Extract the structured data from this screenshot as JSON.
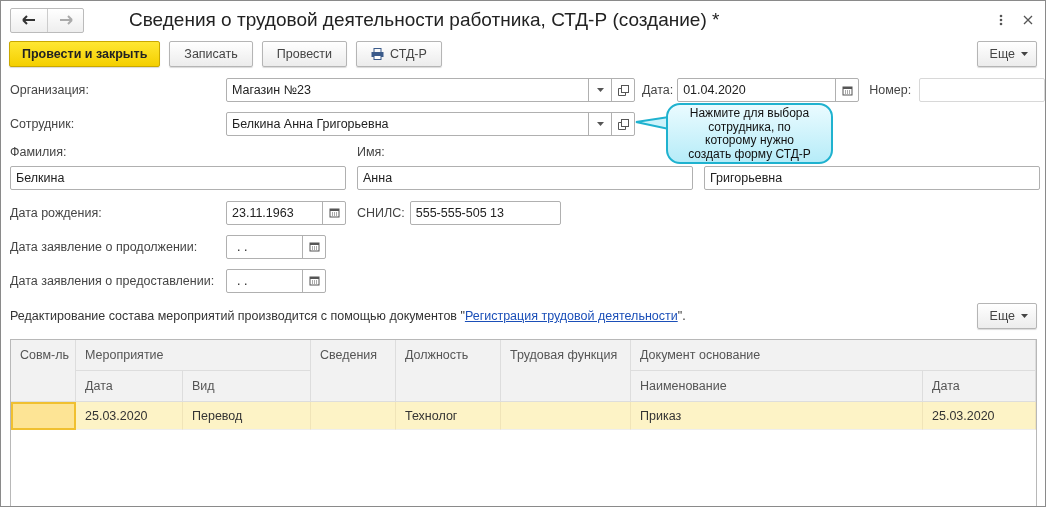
{
  "window": {
    "title": "Сведения о трудовой деятельности работника, СТД-Р (создание) *"
  },
  "toolbar": {
    "buttons": [
      {
        "label": "Провести и закрыть",
        "kind": "primary"
      },
      {
        "label": "Записать",
        "kind": "plain"
      },
      {
        "label": "Провести",
        "kind": "plain"
      },
      {
        "label": "СТД-Р",
        "kind": "print"
      }
    ],
    "more": "Еще"
  },
  "form": {
    "organization": {
      "label": "Организация:",
      "value": "Магазин №23"
    },
    "date": {
      "label": "Дата:",
      "value": "01.04.2020"
    },
    "number": {
      "label": "Номер:"
    },
    "employee": {
      "label": "Сотрудник:",
      "value": "Белкина Анна Григорьевна"
    },
    "last_name": {
      "label": "Фамилия:",
      "value": "Белкина"
    },
    "first_name": {
      "label": "Имя:",
      "value": "Анна"
    },
    "middle_name": {
      "value": "Григорьевна"
    },
    "birth_date": {
      "label": "Дата рождения:",
      "value": "23.11.1963"
    },
    "snils": {
      "label": "СНИЛС:",
      "value": "555-555-505 13"
    },
    "continue_date": {
      "label": "Дата заявление о продолжении:",
      "value": ". ."
    },
    "provide_date": {
      "label": "Дата заявления о предоставлении:",
      "value": ". ."
    }
  },
  "info": {
    "before": "Редактирование состава мероприятий производится с помощью документов \"",
    "link": "Регистрация трудовой деятельности",
    "after": "\"."
  },
  "table_more": "Еще",
  "table": {
    "headers": {
      "combined": "Совм-ль",
      "event": "Мероприятие",
      "event_date": "Дата",
      "event_kind": "Вид",
      "details": "Сведения",
      "position": "Должность",
      "labor_function": "Трудовая функция",
      "basis": "Документ основание",
      "basis_name": "Наименование",
      "basis_date": "Дата"
    },
    "rows": [
      {
        "selected": true,
        "event_date": "25.03.2020",
        "event_kind": "Перевод",
        "position": "Технолог",
        "basis_name": "Приказ",
        "basis_date": "25.03.2020"
      }
    ]
  },
  "callout": {
    "text": "Нажмите для выбора сотрудника, по которому нужно создать форму СТД-Р"
  }
}
